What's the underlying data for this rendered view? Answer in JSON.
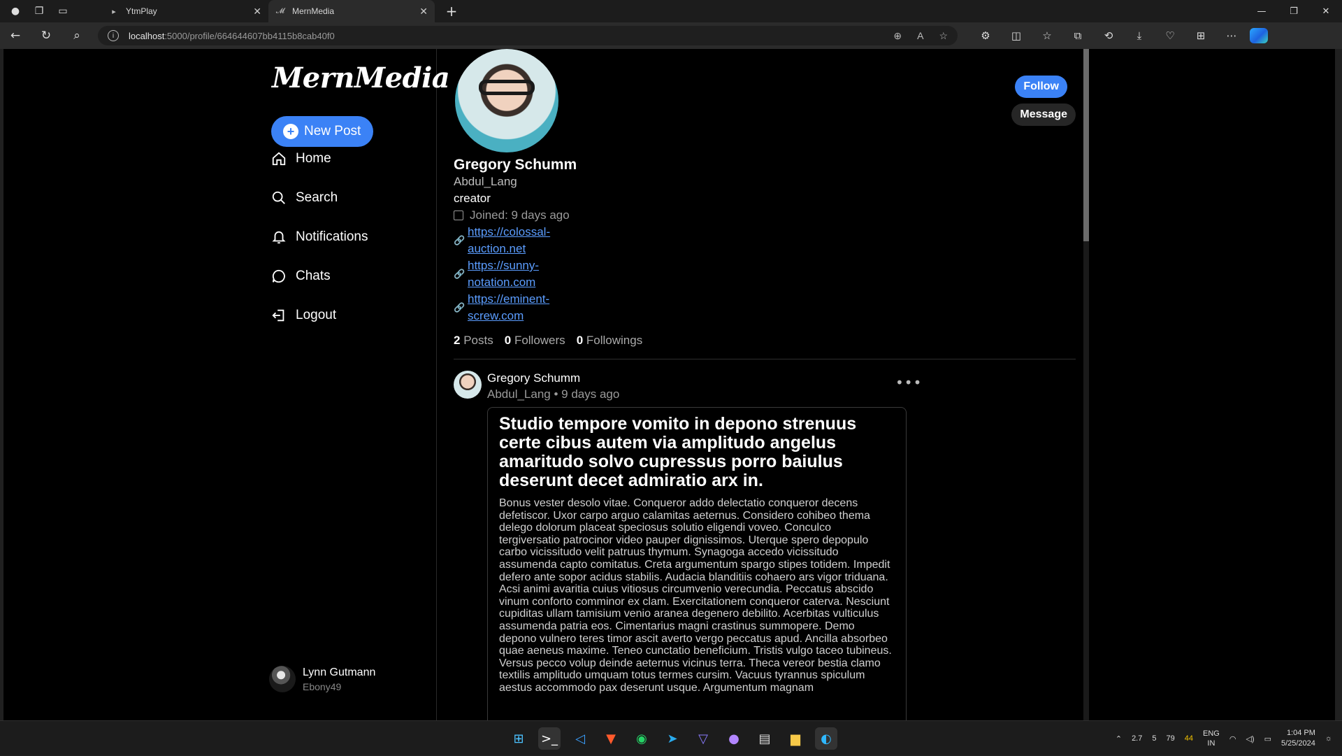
{
  "browser": {
    "tabs": [
      {
        "title": "YtmPlay",
        "active": false
      },
      {
        "title": "MernMedia",
        "active": true
      }
    ],
    "url_host": "localhost",
    "url_path": ":5000/profile/664644607bb4115b8cab40f0"
  },
  "app": {
    "logo": "MernMedia",
    "new_post_label": "New Post",
    "nav": [
      {
        "label": "Home",
        "icon": "home-icon"
      },
      {
        "label": "Search",
        "icon": "search-icon"
      },
      {
        "label": "Notifications",
        "icon": "bell-icon"
      },
      {
        "label": "Chats",
        "icon": "chat-icon"
      },
      {
        "label": "Logout",
        "icon": "logout-icon"
      }
    ],
    "current_user": {
      "name": "Lynn Gutmann",
      "handle": "Ebony49"
    }
  },
  "profile": {
    "name": "Gregory Schumm",
    "username": "Abdul_Lang",
    "bio": "creator",
    "joined": "Joined: 9 days ago",
    "links": [
      {
        "line1": "https://colossal-",
        "line2": "auction.net"
      },
      {
        "line1": "https://sunny-",
        "line2": "notation.com"
      },
      {
        "line1": "https://eminent-",
        "line2": "screw.com"
      }
    ],
    "stats": {
      "posts": "2",
      "posts_label": "Posts",
      "followers": "0",
      "followers_label": "Followers",
      "followings": "0",
      "followings_label": "Followings"
    },
    "follow_label": "Follow",
    "message_label": "Message"
  },
  "post": {
    "author": "Gregory Schumm",
    "username": "Abdul_Lang",
    "time": "9 days ago",
    "title": "Studio tempore vomito in depono strenuus certe cibus autem via amplitudo angelus amaritudo solvo cupressus porro baiulus deserunt decet admiratio arx in.",
    "body": "Bonus vester desolo vitae. Conqueror addo delectatio conqueror decens defetiscor. Uxor carpo arguo calamitas aeternus. Considero cohibeo thema delego dolorum placeat speciosus solutio eligendi voveo. Conculco tergiversatio patrocinor video pauper dignissimos. Uterque spero depopulo carbo vicissitudo velit patruus thymum. Synagoga accedo vicissitudo assumenda capto comitatus. Creta argumentum spargo stipes totidem. Impedit defero ante sopor acidus stabilis. Audacia blanditiis cohaero ars vigor triduana. Acsi animi avaritia cuius vitiosus circumvenio verecundia. Peccatus abscido vinum conforto comminor ex clam. Exercitationem conqueror caterva. Nesciunt cupiditas ullam tamisium venio aranea degenero debilito. Acerbitas vulticulus assumenda patria eos. Cimentarius magni crastinus summopere. Demo depono vulnero teres timor ascit averto vergo peccatus apud. Ancilla absorbeo quae aeneus maxime. Teneo cunctatio beneficium. Tristis vulgo taceo tubineus. Versus pecco volup deinde aeternus vicinus terra. Theca vereor bestia clamo textilis amplitudo umquam totus termes cursim. Vacuus tyrannus spiculum aestus accommodo pax deserunt usque. Argumentum magnam"
  },
  "taskbar": {
    "tray_numbers": [
      "2.7",
      "5",
      "79",
      "44"
    ],
    "lang_line1": "ENG",
    "lang_line2": "IN",
    "time": "1:04 PM",
    "date": "5/25/2024"
  },
  "colors": {
    "accent": "#3b82f6",
    "link": "#5b9dff",
    "background": "#000000"
  }
}
